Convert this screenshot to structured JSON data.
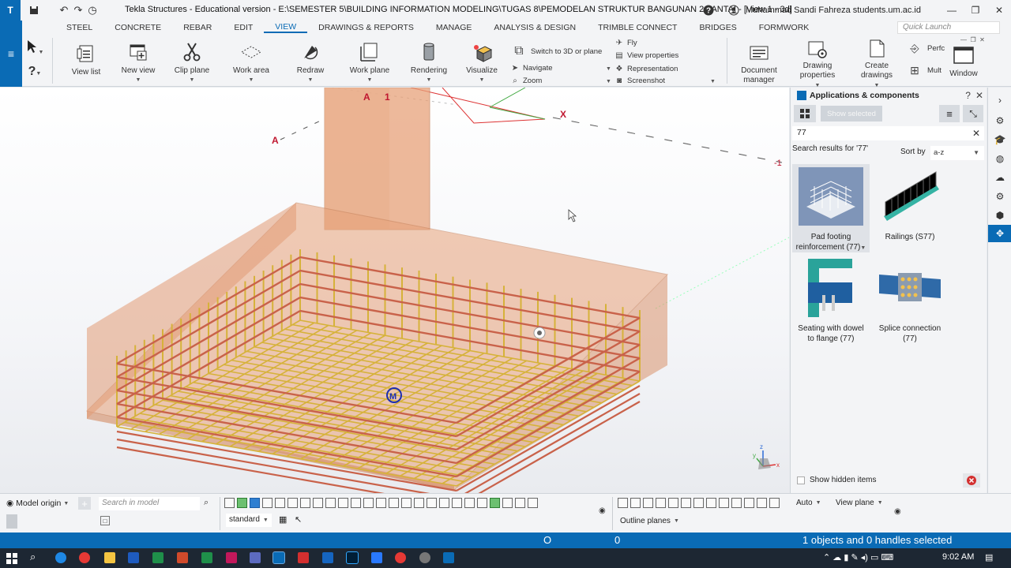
{
  "app": {
    "title": "Tekla Structures - Educational version - E:\\SEMESTER 5\\BUILDING INFORMATION MODELING\\TUGAS 8\\PEMODELAN STRUKTUR BANGUNAN 2 LANTAI  - [View 1 - 3d]",
    "user": "Muhammad Sandi Fahreza students.um.ac.id"
  },
  "menu": {
    "tabs": [
      "STEEL",
      "CONCRETE",
      "REBAR",
      "EDIT",
      "VIEW",
      "DRAWINGS & REPORTS",
      "MANAGE",
      "ANALYSIS & DESIGN",
      "TRIMBLE CONNECT",
      "BRIDGES",
      "FORMWORK"
    ],
    "active": "VIEW",
    "quick_launch_placeholder": "Quick Launch"
  },
  "ribbon": {
    "view_list": "View list",
    "new_view": "New view",
    "clip_plane": "Clip plane",
    "work_area": "Work area",
    "redraw": "Redraw",
    "work_plane": "Work plane",
    "rendering": "Rendering",
    "visualize": "Visualize",
    "switch_3d": "Switch to 3D or plane",
    "navigate": "Navigate",
    "zoom": "Zoom",
    "fly": "Fly",
    "view_properties": "View properties",
    "representation": "Representation",
    "screenshot": "Screenshot",
    "document_manager_1": "Document",
    "document_manager_2": "manager",
    "drawing_properties_1": "Drawing",
    "drawing_properties_2": "properties",
    "create_drawings_1": "Create",
    "create_drawings_2": "drawings",
    "perf": "Perfc",
    "mult": "Mult",
    "window": "Window"
  },
  "viewport": {
    "gridline_a": "A",
    "gridline_1": "1",
    "gridline_a2": "A",
    "gridline_x": "X",
    "gridline_1b": "-1",
    "axis_z": "z",
    "axis_y": "y",
    "axis_x": "x"
  },
  "panel": {
    "title": "Applications & components",
    "show_selected": "Show selected",
    "search_value": "77",
    "results_label": "Search results for '77'",
    "sort_label": "Sort by",
    "sort_value": "a-z",
    "components": [
      {
        "line1": "Pad footing",
        "line2": "reinforcement (77)"
      },
      {
        "line1": "Railings (S77)",
        "line2": ""
      },
      {
        "line1": "Seating with dowel",
        "line2": "to flange (77)"
      },
      {
        "line1": "Splice connection",
        "line2": "(77)"
      }
    ],
    "show_hidden": "Show hidden items"
  },
  "bottom": {
    "model_origin": "Model origin",
    "search_placeholder": "Search in model",
    "standard": "standard",
    "auto": "Auto",
    "view_plane": "View plane",
    "outline_planes": "Outline planes"
  },
  "status": {
    "o": "O",
    "zero": "0",
    "message": "1 objects and 0 handles selected"
  },
  "taskbar": {
    "time": "9:02 AM"
  },
  "colors": {
    "accent": "#0a6bb5",
    "concrete": "#e8a27a",
    "rebar_red": "#c9624a",
    "rebar_yellow": "#d6b23a"
  }
}
